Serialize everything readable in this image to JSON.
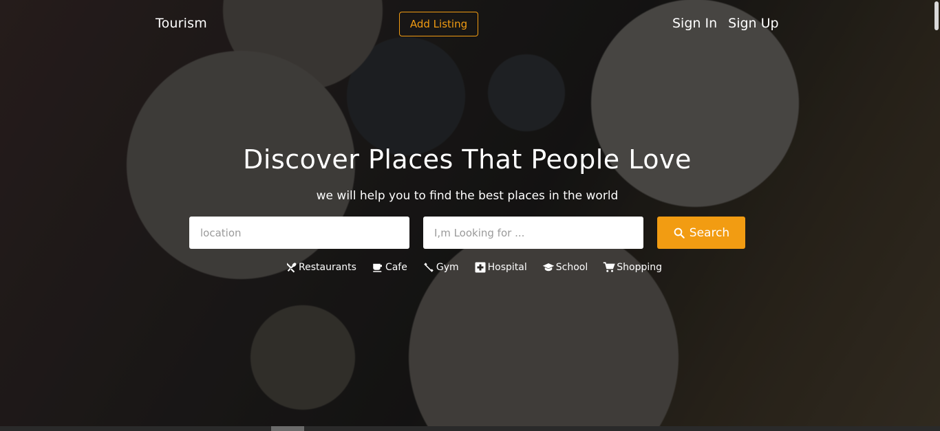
{
  "nav": {
    "brand": "Tourism",
    "add_listing": "Add Listing",
    "sign_in": "Sign In",
    "sign_up": "Sign Up"
  },
  "hero": {
    "title": "Discover Places That People Love",
    "subtitle": "we will help you to find the best places in the world"
  },
  "search": {
    "location_placeholder": "location",
    "looking_placeholder": "I,m Looking for ...",
    "button_label": "Search"
  },
  "categories": [
    {
      "label": "Restaurants",
      "icon": "fork-knife-icon"
    },
    {
      "label": "Cafe",
      "icon": "coffee-cup-icon"
    },
    {
      "label": "Gym",
      "icon": "dumbbell-icon"
    },
    {
      "label": "Hospital",
      "icon": "medical-cross-icon"
    },
    {
      "label": "School",
      "icon": "graduation-cap-icon"
    },
    {
      "label": "Shopping",
      "icon": "shopping-cart-icon"
    }
  ],
  "colors": {
    "accent": "#f29c12",
    "text": "#ffffff"
  }
}
